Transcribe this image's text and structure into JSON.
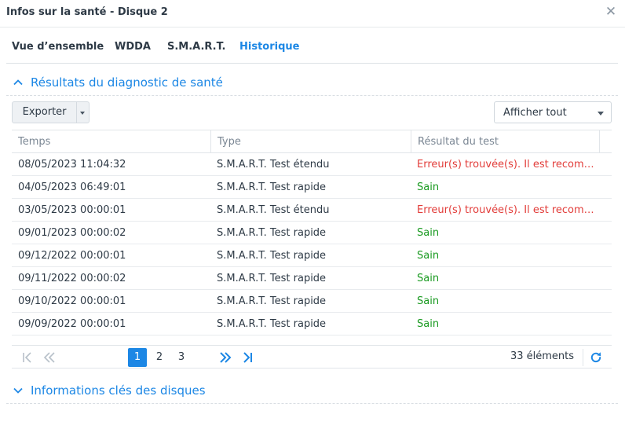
{
  "window": {
    "title": "Infos sur la santé - Disque 2",
    "close_glyph": "✕"
  },
  "tabs": [
    {
      "label": "Vue d’ensemble",
      "active": false
    },
    {
      "label": "WDDA",
      "active": false
    },
    {
      "label": "S.M.A.R.T.",
      "active": false
    },
    {
      "label": "Historique",
      "active": true
    }
  ],
  "diagnostic_section": {
    "title": "Résultats du diagnostic de santé",
    "expanded": true,
    "icon": "chevron-up-icon"
  },
  "toolbar": {
    "export_label": "Exporter",
    "filter_value": "Afficher tout"
  },
  "table": {
    "columns": [
      "Temps",
      "Type",
      "Résultat du test"
    ],
    "rows": [
      {
        "time": "08/05/2023 11:04:32",
        "type": "S.M.A.R.T. Test étendu",
        "result": "Erreur(s) trouvée(s). Il est recommandé",
        "status": "error"
      },
      {
        "time": "04/05/2023 06:49:01",
        "type": "S.M.A.R.T. Test rapide",
        "result": "Sain",
        "status": "ok"
      },
      {
        "time": "03/05/2023 00:00:01",
        "type": "S.M.A.R.T. Test étendu",
        "result": "Erreur(s) trouvée(s). Il est recommandé",
        "status": "error"
      },
      {
        "time": "09/01/2023 00:00:02",
        "type": "S.M.A.R.T. Test rapide",
        "result": "Sain",
        "status": "ok"
      },
      {
        "time": "09/12/2022 00:00:01",
        "type": "S.M.A.R.T. Test rapide",
        "result": "Sain",
        "status": "ok"
      },
      {
        "time": "09/11/2022 00:00:02",
        "type": "S.M.A.R.T. Test rapide",
        "result": "Sain",
        "status": "ok"
      },
      {
        "time": "09/10/2022 00:00:01",
        "type": "S.M.A.R.T. Test rapide",
        "result": "Sain",
        "status": "ok"
      },
      {
        "time": "09/09/2022 00:00:01",
        "type": "S.M.A.R.T. Test rapide",
        "result": "Sain",
        "status": "ok"
      }
    ]
  },
  "pagination": {
    "pages": [
      "1",
      "2",
      "3"
    ],
    "current": "1",
    "count_text": "33 éléments"
  },
  "disk_info_section": {
    "title": "Informations clés des disques",
    "expanded": false,
    "icon": "chevron-down-icon"
  },
  "colors": {
    "accent": "#1c87e5",
    "error": "#e23c39",
    "ok": "#1a9a21"
  }
}
